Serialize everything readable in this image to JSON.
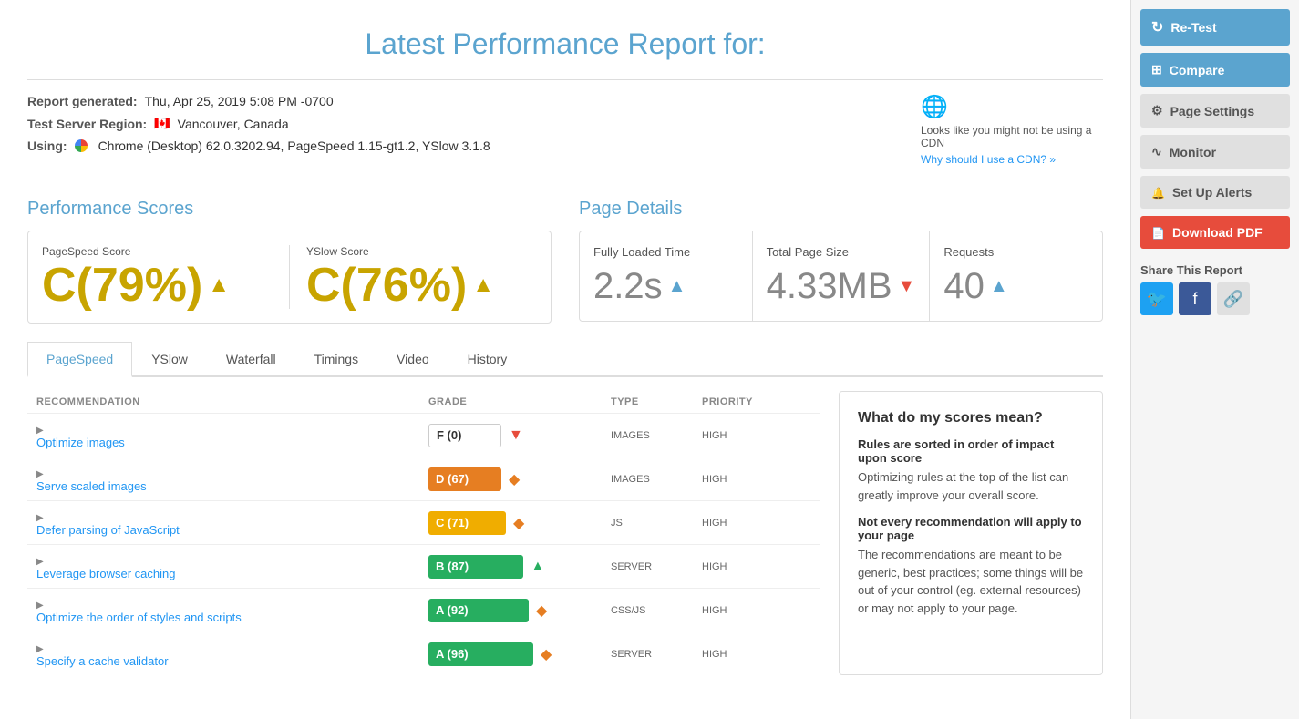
{
  "header": {
    "title": "Latest Performance Report for:"
  },
  "report_meta": {
    "generated_label": "Report generated:",
    "generated_value": "Thu, Apr 25, 2019 5:08 PM -0700",
    "server_label": "Test Server Region:",
    "server_flag": "🇨🇦",
    "server_value": "Vancouver, Canada",
    "using_label": "Using:",
    "using_value": "Chrome (Desktop) 62.0.3202.94, PageSpeed 1.15-gt1.2, YSlow 3.1.8",
    "cdn_text": "Looks like you might not be using a CDN",
    "cdn_link": "Why should I use a CDN? »"
  },
  "performance_scores": {
    "title": "Performance Scores",
    "pagespeed": {
      "label": "PageSpeed Score",
      "value": "C(79%)",
      "arrow": "▲"
    },
    "yslow": {
      "label": "YSlow Score",
      "value": "C(76%)",
      "arrow": "▲"
    }
  },
  "page_details": {
    "title": "Page Details",
    "loaded_time": {
      "label": "Fully Loaded Time",
      "value": "2.2s",
      "arrow": "▲",
      "arrow_type": "up"
    },
    "page_size": {
      "label": "Total Page Size",
      "value": "4.33MB",
      "arrow": "▼",
      "arrow_type": "down"
    },
    "requests": {
      "label": "Requests",
      "value": "40",
      "arrow": "▲",
      "arrow_type": "up"
    }
  },
  "tabs": [
    {
      "id": "pagespeed",
      "label": "PageSpeed",
      "active": true
    },
    {
      "id": "yslow",
      "label": "YSlow",
      "active": false
    },
    {
      "id": "waterfall",
      "label": "Waterfall",
      "active": false
    },
    {
      "id": "timings",
      "label": "Timings",
      "active": false
    },
    {
      "id": "video",
      "label": "Video",
      "active": false
    },
    {
      "id": "history",
      "label": "History",
      "active": false
    }
  ],
  "table": {
    "headers": {
      "recommendation": "RECOMMENDATION",
      "grade": "GRADE",
      "type": "TYPE",
      "priority": "PRIORITY"
    },
    "rows": [
      {
        "rec": "Optimize images",
        "grade_label": "F (0)",
        "grade_class": "grade-f",
        "grade_pct": 0,
        "icon": "▼",
        "icon_type": "red",
        "type": "IMAGES",
        "priority": "HIGH"
      },
      {
        "rec": "Serve scaled images",
        "grade_label": "D (67)",
        "grade_class": "grade-d",
        "grade_pct": 67,
        "icon": "◆",
        "icon_type": "orange",
        "type": "IMAGES",
        "priority": "HIGH"
      },
      {
        "rec": "Defer parsing of JavaScript",
        "grade_label": "C (71)",
        "grade_class": "grade-c",
        "grade_pct": 71,
        "icon": "◆",
        "icon_type": "orange",
        "type": "JS",
        "priority": "HIGH"
      },
      {
        "rec": "Leverage browser caching",
        "grade_label": "B (87)",
        "grade_class": "grade-b",
        "grade_pct": 87,
        "icon": "▲",
        "icon_type": "green",
        "type": "SERVER",
        "priority": "HIGH"
      },
      {
        "rec": "Optimize the order of styles and scripts",
        "grade_label": "A (92)",
        "grade_class": "grade-a",
        "grade_pct": 92,
        "icon": "◆",
        "icon_type": "orange",
        "type": "CSS/JS",
        "priority": "HIGH"
      },
      {
        "rec": "Specify a cache validator",
        "grade_label": "A (96)",
        "grade_class": "grade-a",
        "grade_pct": 96,
        "icon": "◆",
        "icon_type": "orange",
        "type": "SERVER",
        "priority": "HIGH"
      }
    ]
  },
  "info_box": {
    "title": "What do my scores mean?",
    "subtitle1": "Rules are sorted in order of impact upon score",
    "text1": "Optimizing rules at the top of the list can greatly improve your overall score.",
    "subtitle2": "Not every recommendation will apply to your page",
    "text2": "The recommendations are meant to be generic, best practices; some things will be out of your control (eg. external resources) or may not apply to your page."
  },
  "sidebar": {
    "retest_label": "Re-Test",
    "compare_label": "Compare",
    "settings_label": "Page Settings",
    "monitor_label": "Monitor",
    "alerts_label": "Set Up Alerts",
    "pdf_label": "Download PDF",
    "share_label": "Share This Report"
  }
}
